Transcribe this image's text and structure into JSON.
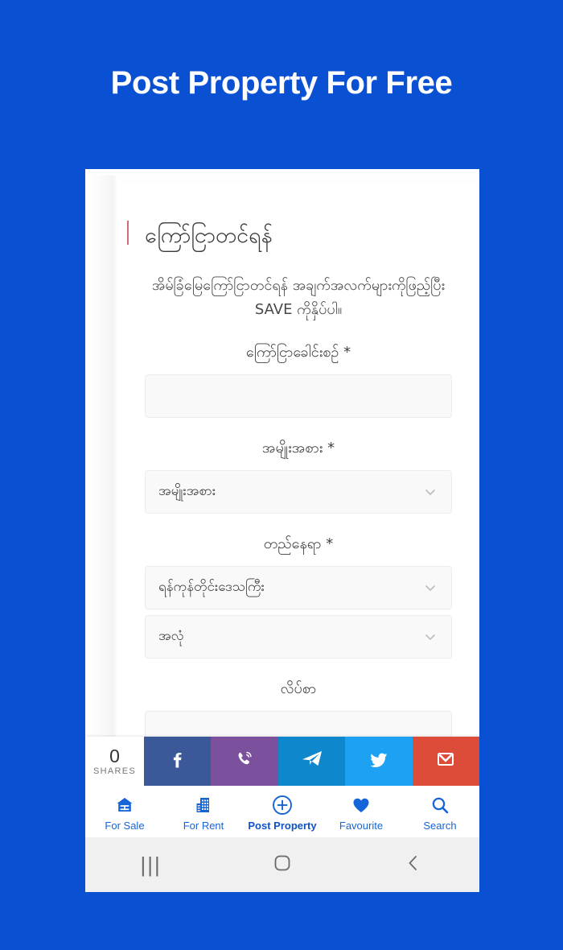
{
  "banner": {
    "title": "Post Property For Free",
    "background_color": "#0a50d2"
  },
  "form": {
    "heading": "ကြော်ငြာတင်ရန်",
    "heading_accent_color": "#d46a7e",
    "description": "အိမ်ခြံမြေကြော်ငြာတင်ရန် အချက်အလက်များကိုဖြည့်ပြီး SAVE ကိုနှိပ်ပါ။",
    "fields": {
      "title_label": "ကြော်ငြာခေါင်းစဉ် *",
      "title_value": "",
      "type_label": "အမျိုးအစား *",
      "type_value": "အမျိုးအစား",
      "location_label": "တည်နေရာ *",
      "region_value": "ရန်ကုန်တိုင်းဒေသကြီး",
      "township_value": "အလုံ",
      "address_label": "လိပ်စာ",
      "address_value": ""
    }
  },
  "share_bar": {
    "count": "0",
    "count_label": "SHARES",
    "buttons": [
      {
        "name": "facebook",
        "label": "f",
        "color": "#3b5998"
      },
      {
        "name": "viber",
        "label": "Viber",
        "color": "#7b519d"
      },
      {
        "name": "telegram",
        "label": "Telegram",
        "color": "#0e87cc"
      },
      {
        "name": "twitter",
        "label": "Twitter",
        "color": "#1da1f2"
      },
      {
        "name": "gmail",
        "label": "Gmail",
        "color": "#dd4b39"
      }
    ]
  },
  "app_nav": {
    "accent_color": "#1565d8",
    "items": [
      {
        "label": "For Sale",
        "icon": "home-icon",
        "active": false
      },
      {
        "label": "For Rent",
        "icon": "building-icon",
        "active": false
      },
      {
        "label": "Post Property",
        "icon": "plus-circle-icon",
        "active": true
      },
      {
        "label": "Favourite",
        "icon": "heart-icon",
        "active": false
      },
      {
        "label": "Search",
        "icon": "search-icon",
        "active": false
      }
    ]
  },
  "system_bar": {
    "recents": "|||",
    "home": "home-square-icon",
    "back": "chevron-left-icon"
  }
}
